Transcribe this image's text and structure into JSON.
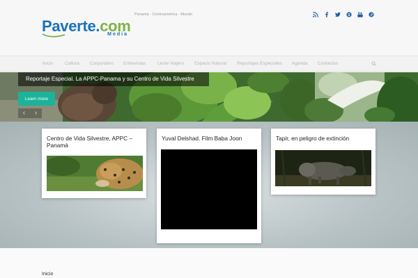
{
  "header": {
    "logo": {
      "main": "Paverte",
      "dot": ".",
      "tld": "com",
      "sub": "Media"
    },
    "tagline": "Panamá - Centroamérica - Mundo",
    "social": [
      "rss-icon",
      "facebook-icon",
      "twitter-icon",
      "skype-icon",
      "youtube-icon",
      "pinterest-icon"
    ]
  },
  "nav": {
    "items": [
      "Inicio",
      "Cultura",
      "Corporativo",
      "Entrevistas",
      "Lente Viajero",
      "Espacio Natural",
      "Reportajes Especiales",
      "Agenda",
      "Contactos"
    ]
  },
  "slider": {
    "caption": "Reportaje Especial. La APPC-Panama y su Centro de Vida Silvestre",
    "button": "Learn more",
    "prev_glyph": "‹",
    "next_glyph": "›"
  },
  "cards": [
    {
      "title": "Centro de Vida Silvestre, APPC – Panamá"
    },
    {
      "title": "Yuval Delshad. Film Baba Joon"
    },
    {
      "title": "Tapir, en peligro de extinción"
    }
  ],
  "footer": {
    "label": "Inicio"
  },
  "colors": {
    "brand_blue": "#1a73b8",
    "brand_green": "#7cb342",
    "accent": "#1bb39a",
    "social": "#1f5fa8"
  }
}
